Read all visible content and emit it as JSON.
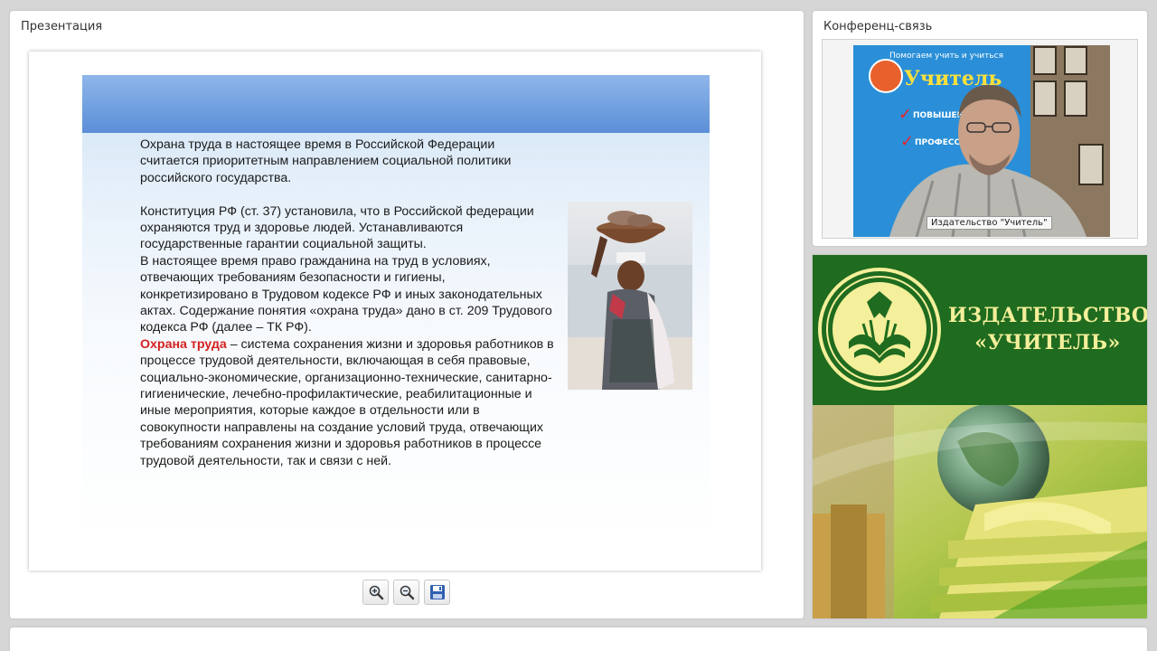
{
  "presentation": {
    "title": "Презентация",
    "slide": {
      "paragraph1": "Охрана труда в настоящее время в Российской Федерации считается приоритетным направлением социальной политики российского государства.",
      "paragraph2": "Конституция РФ (ст. 37) установила, что в Российской федерации охраняются труд и здоровье людей. Устанавливаются государственные гарантии социальной защиты.",
      "paragraph3": "В настоящее время право гражданина на труд в условиях, отвечающих требованиям безопасности и гигиены, конкретизировано в Трудовом кодексе РФ и иных законодательных актах. Содержание понятия «охрана труда» дано в ст. 209 Трудового кодекса РФ (далее – ТК РФ).",
      "term": "Охрана труда",
      "definition": " – система сохранения жизни и здоровья работников в процессе трудовой деятельности, включающая в себя правовые, социально-экономические, организационно-технические, санитарно-гигиенические, лечебно-профилактические, реабилитационные и иные мероприятия, которые каждое в отдельности или в совокупности направлены на создание условий труда, отвечающих требованиям сохранения жизни и здоровья работников в процессе трудовой деятельности, так и связи с ней."
    },
    "toolbar": {
      "zoom_in_icon": "zoom-in-icon",
      "zoom_out_icon": "zoom-out-icon",
      "save_icon": "floppy-disk-icon"
    }
  },
  "conference": {
    "title": "Конференц-связь",
    "participant_name": "Издательство \"Учитель\"",
    "poster_line1": "Помогаем учить и учиться",
    "poster_logo": "Учитель",
    "poster_item1": "ПОВЫШЕНИЕ",
    "poster_item2": "ПРОФЕСС"
  },
  "brand": {
    "line1": "ИЗДАТЕЛЬСТВО",
    "line2": "«УЧИТЕЛЬ»",
    "colors": {
      "green": "#1f6b1f",
      "yellow": "#f4ef9a"
    }
  }
}
